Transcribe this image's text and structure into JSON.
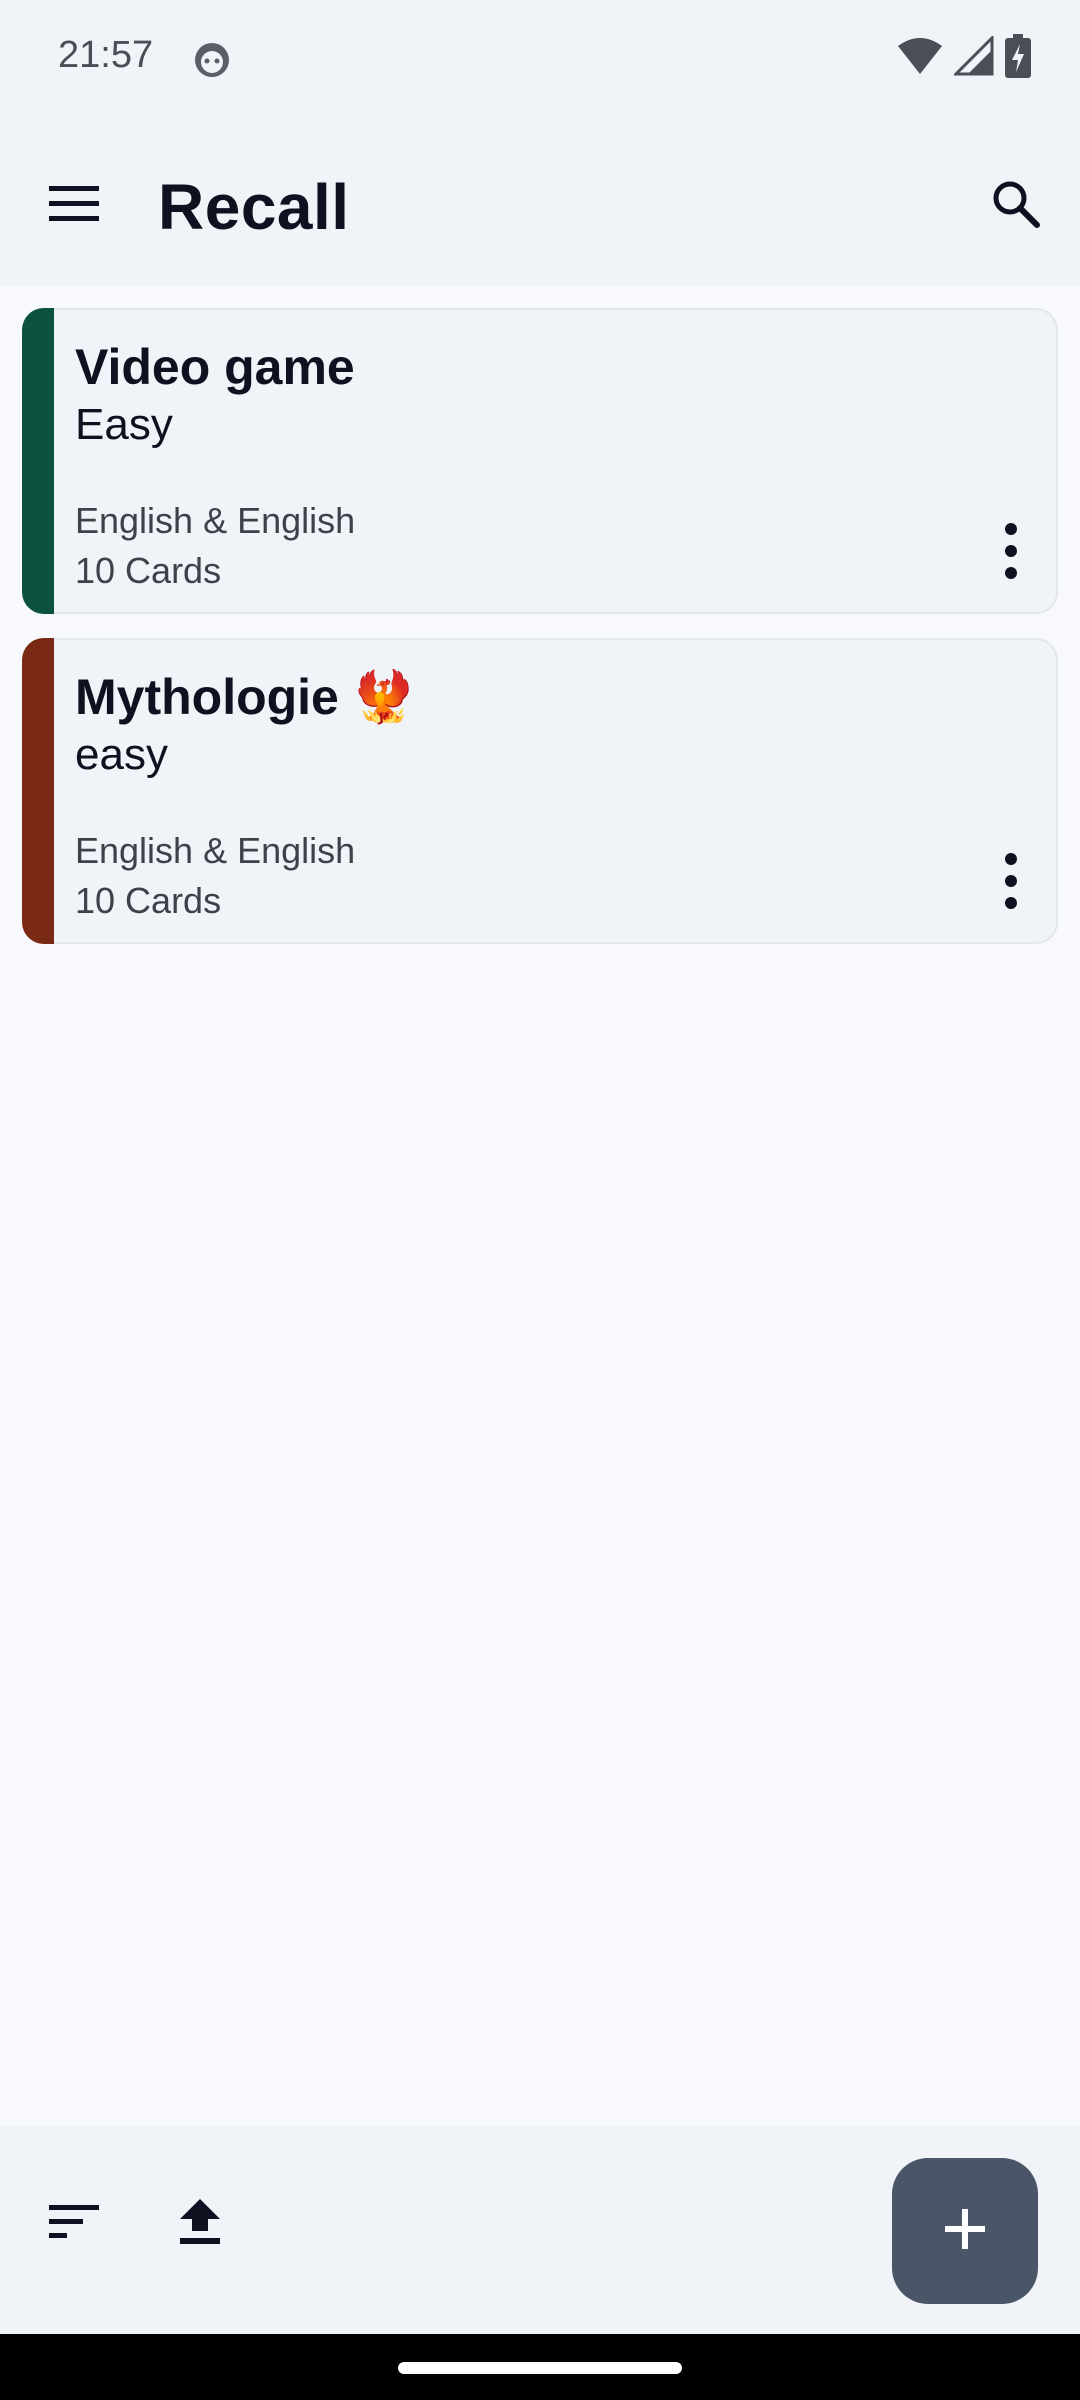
{
  "status_bar": {
    "time": "21:57",
    "icons": [
      "notification-icon",
      "wifi-icon",
      "signal-icon",
      "battery-charging-icon"
    ]
  },
  "app_bar": {
    "title": "Recall",
    "menu_icon": "menu-icon",
    "search_icon": "search-icon"
  },
  "decks": [
    {
      "title": "Video game",
      "difficulty": "Easy",
      "languages": "English & English",
      "cards": "10 Cards",
      "color": "#0B5340"
    },
    {
      "title": "Mythologie 🐦‍🔥",
      "difficulty": "easy",
      "languages": "English & English",
      "cards": "10 Cards",
      "color": "#7A2A14"
    }
  ],
  "bottom_bar": {
    "sort_icon": "sort-icon",
    "upload_icon": "upload-icon",
    "fab_icon": "plus-icon"
  },
  "colors": {
    "background": "#F8F9FC",
    "surface": "#F0F3F8",
    "fab": "#4A5568"
  }
}
